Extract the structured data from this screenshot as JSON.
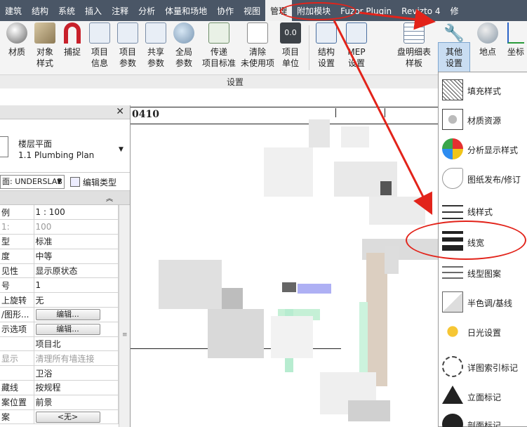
{
  "tabs": [
    {
      "label": "建筑",
      "active": false
    },
    {
      "label": "结构",
      "active": false
    },
    {
      "label": "系统",
      "active": false
    },
    {
      "label": "插入",
      "active": false
    },
    {
      "label": "注释",
      "active": false
    },
    {
      "label": "分析",
      "active": false
    },
    {
      "label": "体量和场地",
      "active": false
    },
    {
      "label": "协作",
      "active": false
    },
    {
      "label": "视图",
      "active": false
    },
    {
      "label": "管理",
      "active": true
    },
    {
      "label": "附加模块",
      "active": false
    },
    {
      "label": "Fuzor Plugin",
      "active": false
    },
    {
      "label": "Revizto 4",
      "active": false
    },
    {
      "label": "修",
      "active": false
    }
  ],
  "ribbon": {
    "buttons": [
      {
        "label": "材质",
        "icon": "material-sphere-icon"
      },
      {
        "label": "对象\n样式",
        "icon": "object-styles-icon"
      },
      {
        "label": "捕捉",
        "icon": "snap-magnet-icon"
      },
      {
        "label": "项目\n信息",
        "icon": "project-info-icon"
      },
      {
        "label": "项目\n参数",
        "icon": "project-parameters-icon"
      },
      {
        "label": "共享\n参数",
        "icon": "shared-parameters-icon"
      },
      {
        "label": "全局\n参数",
        "icon": "global-parameters-icon"
      },
      {
        "label": "传递\n项目标准",
        "icon": "transfer-standards-icon"
      },
      {
        "label": "清除\n未使用项",
        "icon": "purge-unused-icon"
      },
      {
        "label": "项目\n单位",
        "icon": "project-units-icon"
      },
      {
        "label": "结构\n设置",
        "icon": "structural-settings-icon"
      },
      {
        "label": "MEP\n设置",
        "icon": "mep-settings-icon"
      },
      {
        "label": "盘明细表\n样板",
        "icon": "panel-schedule-icon"
      },
      {
        "label": "其他\n设置",
        "icon": "wrench-icon"
      },
      {
        "label": "地点",
        "icon": "location-globe-icon"
      },
      {
        "label": "坐标",
        "icon": "coordinates-icon"
      }
    ],
    "panel_title": "设置"
  },
  "properties": {
    "type_category": "楼层平面",
    "type_name": "1.1 Plumbing Plan",
    "selector": "面: UNDERSLAB",
    "edit_type": "编辑类型",
    "rows": [
      {
        "key": "例",
        "value": "1 : 100",
        "dim": false,
        "button": false
      },
      {
        "key": "1:",
        "value": "100",
        "dim": true,
        "button": false
      },
      {
        "key": "型",
        "value": "标准",
        "dim": false,
        "button": false
      },
      {
        "key": "度",
        "value": "中等",
        "dim": false,
        "button": false
      },
      {
        "key": "见性",
        "value": "显示原状态",
        "dim": false,
        "button": false
      },
      {
        "key": "号",
        "value": "1",
        "dim": false,
        "button": false
      },
      {
        "key": "上旋转",
        "value": "无",
        "dim": false,
        "button": false
      },
      {
        "key": "/图形...",
        "value": "编辑...",
        "dim": false,
        "button": true
      },
      {
        "key": "示选项",
        "value": "编辑...",
        "dim": false,
        "button": true
      },
      {
        "key": "",
        "value": "项目北",
        "dim": false,
        "button": false
      },
      {
        "key": "显示",
        "value": "清理所有墙连接",
        "dim": true,
        "button": false
      },
      {
        "key": "",
        "value": "卫浴",
        "dim": false,
        "button": false
      },
      {
        "key": "藏线",
        "value": "按规程",
        "dim": false,
        "button": false
      },
      {
        "key": "案位置",
        "value": "前景",
        "dim": false,
        "button": false
      },
      {
        "key": "案",
        "value": "<无>",
        "dim": false,
        "button": true
      }
    ]
  },
  "canvas": {
    "label": "0410"
  },
  "menu": {
    "items": [
      {
        "label": "填充样式",
        "icon": "fill-patterns-icon"
      },
      {
        "label": "材质资源",
        "icon": "material-assets-icon"
      },
      {
        "label": "分析显示样式",
        "icon": "analysis-display-icon"
      },
      {
        "label": "图纸发布/修订",
        "icon": "sheet-issues-icon"
      },
      {
        "label": "线样式",
        "icon": "line-styles-icon"
      },
      {
        "label": "线宽",
        "icon": "line-weights-icon"
      },
      {
        "label": "线型图案",
        "icon": "line-patterns-icon"
      },
      {
        "label": "半色调/基线",
        "icon": "halftone-underlay-icon"
      },
      {
        "label": "日光设置",
        "icon": "sun-settings-icon"
      },
      {
        "label": "详图索引标记",
        "icon": "callout-tags-icon"
      },
      {
        "label": "立面标记",
        "icon": "elevation-tags-icon"
      },
      {
        "label": "剖面标记",
        "icon": "section-tags-icon"
      }
    ]
  },
  "annotation_color": "#e2231a"
}
